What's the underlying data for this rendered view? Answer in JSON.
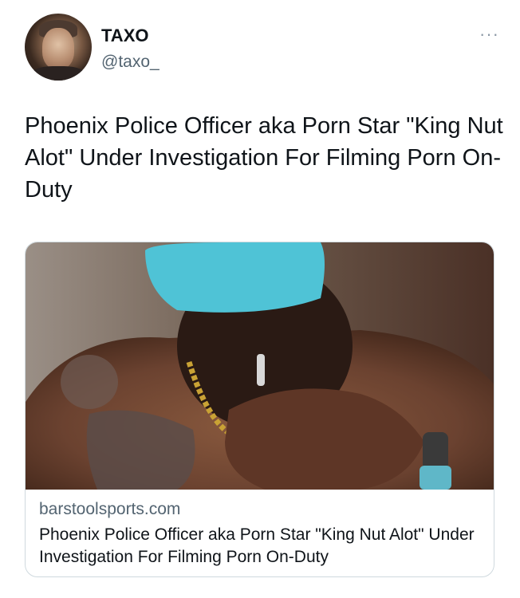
{
  "tweet": {
    "author": {
      "display_name": "TAXO",
      "handle": "@taxo_"
    },
    "more_icon": "ellipsis-icon",
    "text": "Phoenix Police Officer aka Porn Star \"King Nut Alot\" Under Investigation For Filming Porn On-Duty"
  },
  "card": {
    "image_description": "photo-thumbnail",
    "domain": "barstoolsports.com",
    "title": "Phoenix Police Officer aka Porn Star \"King Nut Alot\" Under Investigation For Filming Porn On-Duty"
  },
  "colors": {
    "text_primary": "#0f1419",
    "text_secondary": "#536471",
    "border": "#cfd9de",
    "cap": "#4fc3d6"
  }
}
